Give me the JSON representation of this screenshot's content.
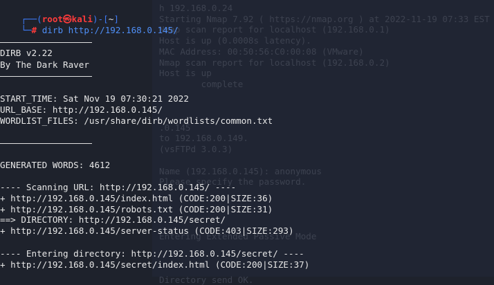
{
  "background_ghost_lines": [
    "h 192.168.0.24",
    "Starting Nmap 7.92 ( https://nmap.org ) at 2022-11-19 07:33 EST",
    "Nmap scan report for localhost (192.168.0.1)",
    "Host is up (0.0008s latency).",
    "MAC Address: 00:50:56:C0:00:08 (VMware)",
    "Nmap scan report for localhost (192.168.0.2)",
    "Host is up",
    "        complete",
    "",
    "",
    "",
    ".0.145",
    "to 192.168.0.149.",
    "(vsFTPd 3.0.3)",
    "",
    "Name (192.168.0.145): anonymous",
    "Please specify the password.",
    "",
    "",
    "",
    "",
    "Entering Extended Passive Mode",
    "",
    "",
    "",
    "Directory send OK."
  ],
  "prompt": {
    "top_prefix": "┌──(",
    "user": "root",
    "at": "㉿",
    "host": "kali",
    "mid": ")-[",
    "cwd": "~",
    "close": "]",
    "bottom_prefix": "└─",
    "hash": "#",
    "command": "dirb http://192.168.0.145/"
  },
  "banner": {
    "version": "DIRB v2.22",
    "author": "By The Dark Raver"
  },
  "info": {
    "start_time": "START_TIME: Sat Nov 19 07:30:21 2022",
    "url_base": "URL_BASE: http://192.168.0.145/",
    "wordlist": "WORDLIST_FILES: /usr/share/dirb/wordlists/common.txt"
  },
  "generated_words": "GENERATED WORDS: 4612",
  "scan_header": "---- Scanning URL: http://192.168.0.145/ ----",
  "results": [
    "+ http://192.168.0.145/index.html (CODE:200|SIZE:36)",
    "+ http://192.168.0.145/robots.txt (CODE:200|SIZE:31)",
    "==> DIRECTORY: http://192.168.0.145/secret/",
    "+ http://192.168.0.145/server-status (CODE:403|SIZE:293)"
  ],
  "enter_header": "---- Entering directory: http://192.168.0.145/secret/ ----",
  "enter_results": [
    "+ http://192.168.0.145/secret/index.html (CODE:200|SIZE:37)"
  ],
  "colors": {
    "background": "#1e222c",
    "prompt_blue": "#3d7bf7",
    "prompt_red": "#ff3b3b",
    "text": "#e8e8e8"
  }
}
